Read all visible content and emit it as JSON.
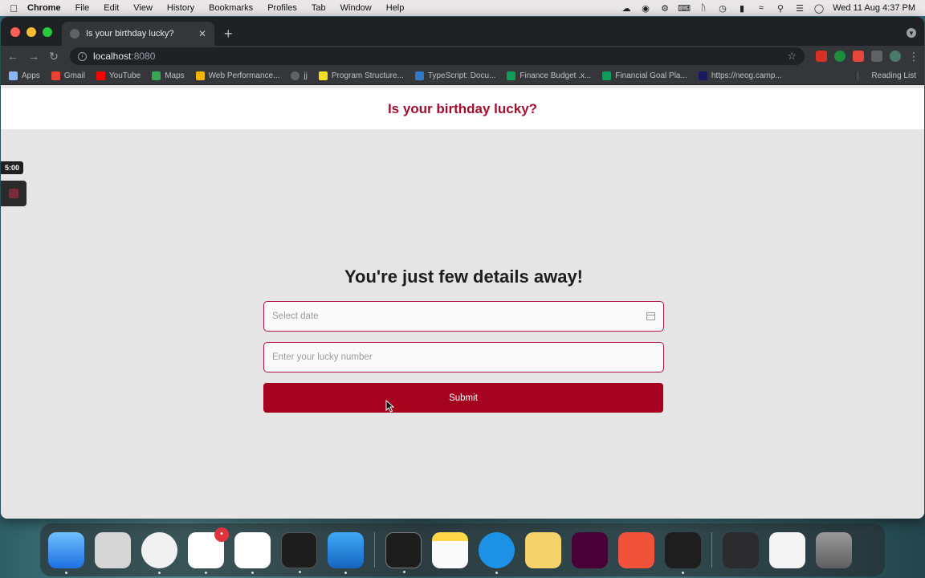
{
  "menubar": {
    "app_name": "Chrome",
    "items": [
      "File",
      "Edit",
      "View",
      "History",
      "Bookmarks",
      "Profiles",
      "Tab",
      "Window",
      "Help"
    ],
    "clock": "Wed 11 Aug  4:37 PM"
  },
  "browser": {
    "tab_title": "Is your birthday lucky?",
    "url_host": "localhost",
    "url_port": ":8080",
    "bookmarks": [
      {
        "label": "Apps",
        "color": "#8ab4f8"
      },
      {
        "label": "Gmail",
        "color": "#ea4335"
      },
      {
        "label": "YouTube",
        "color": "#ff0000"
      },
      {
        "label": "Maps",
        "color": "#34a853"
      },
      {
        "label": "Web Performance...",
        "color": "#f4b400"
      },
      {
        "label": "jj",
        "color": "#5f6368"
      },
      {
        "label": "Program Structure...",
        "color": "#f7df1e"
      },
      {
        "label": "TypeScript: Docu...",
        "color": "#3178c6"
      },
      {
        "label": "Finance Budget .x...",
        "color": "#0f9d58"
      },
      {
        "label": "Financial Goal Pla...",
        "color": "#0f9d58"
      },
      {
        "label": "https://neog.camp...",
        "color": "#1a1a5e"
      }
    ],
    "reading_list": "Reading List"
  },
  "page": {
    "header_title": "Is your birthday lucky?",
    "timer": "5:00",
    "heading": "You're just few details away!",
    "date_placeholder": "Select date",
    "number_placeholder": "Enter your lucky number",
    "submit_label": "Submit"
  },
  "dock": {
    "slack_badge": "•"
  },
  "colors": {
    "accent": "#a50d2e",
    "button": "#a5021f"
  }
}
